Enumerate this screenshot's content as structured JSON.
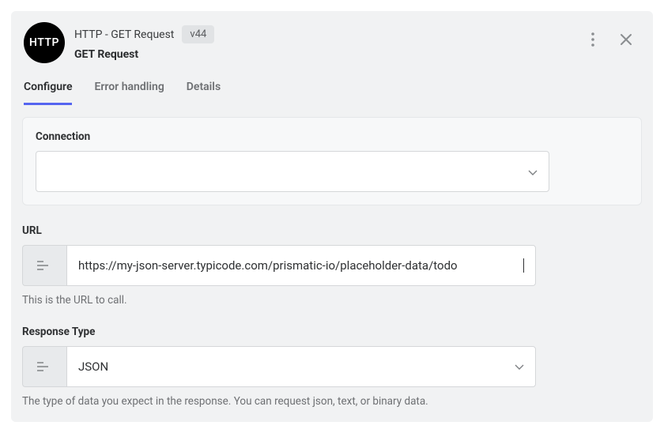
{
  "header": {
    "avatar_text": "HTTP",
    "title": "HTTP - GET Request",
    "version": "v44",
    "subtitle": "GET Request"
  },
  "tabs": {
    "configure": "Configure",
    "error_handling": "Error handling",
    "details": "Details"
  },
  "fields": {
    "connection": {
      "label": "Connection",
      "value": ""
    },
    "url": {
      "label": "URL",
      "value": "https://my-json-server.typicode.com/prismatic-io/placeholder-data/todo",
      "help": "This is the URL to call."
    },
    "response_type": {
      "label": "Response Type",
      "value": "JSON",
      "help": "The type of data you expect in the response. You can request json, text, or binary data."
    }
  }
}
